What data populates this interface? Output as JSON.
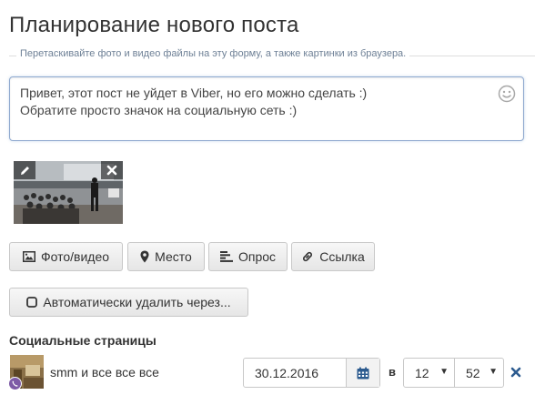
{
  "page": {
    "title": "Планирование нового поста",
    "hint": "Перетаскивайте фото и видео файлы на эту форму, а также картинки из браузера."
  },
  "composer": {
    "text": "Привет, этот пост не уйдет в Viber, но его можно сделать :)\nОбратите просто значок на социальную сеть :)",
    "emoji_icon": "smiley-icon"
  },
  "attachment": {
    "edit_icon": "pencil-icon",
    "remove_icon": "close-icon"
  },
  "toolbar": {
    "photo_label": "Фото/видео",
    "place_label": "Место",
    "poll_label": "Опрос",
    "link_label": "Ссылка",
    "autodelete_label": "Автоматически удалить через..."
  },
  "social": {
    "heading": "Социальные страницы",
    "pages": [
      {
        "name": "smm и все все все",
        "network": "Viber",
        "network_color": "#7d5aa6",
        "date": "30.12.2016",
        "at_label": "в",
        "hour": "12",
        "minute": "52"
      }
    ]
  },
  "colors": {
    "accent_blue": "#2c5b8f",
    "border": "#c8c8c8",
    "focus_border": "#8fa9cf"
  }
}
